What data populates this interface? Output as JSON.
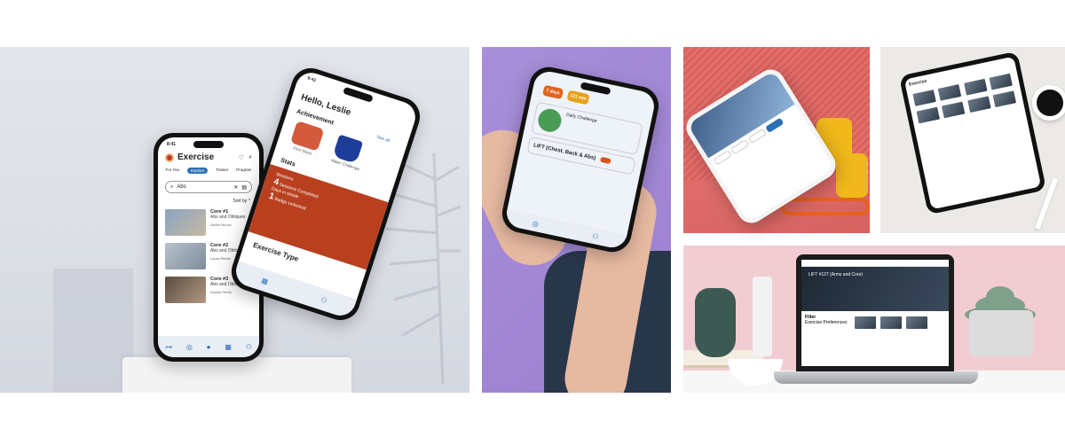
{
  "phone1": {
    "time": "8:41",
    "title": "Exercise",
    "tabs": [
      "For You",
      "Explore",
      "Trainer",
      "Program"
    ],
    "search_value": "Abs",
    "sort_label": "Sort by",
    "cards": [
      {
        "title": "Core #1",
        "subtitle": "Abs and Obliques",
        "author": "Ashim Nunez"
      },
      {
        "title": "Core #2",
        "subtitle": "Abs and Obliques",
        "author": "Laura Reese"
      },
      {
        "title": "Core #3",
        "subtitle": "Abs and Obliques",
        "author": "Amelia Peres"
      }
    ]
  },
  "phone2": {
    "time": "9:41",
    "greeting": "Hello, Leslie",
    "achievement": "Achievement",
    "see_all": "See all",
    "items": [
      "First Steps",
      "Water Challenge"
    ],
    "stats": "Stats",
    "sessions": "Sessions",
    "sessions_count": "4",
    "sessions_label": "Sessions Completed",
    "sessions_day": "Days in streak",
    "badge_count": "1",
    "badge_label": "Badge Unlocked",
    "exercise_type": "Exercise Type"
  },
  "phone3": {
    "badge1": "7 days",
    "badge2": "121 min",
    "challenge_title": "Daily Challenge",
    "lift_label": "LIFT (Chest, Back & Abs)"
  },
  "laptop": {
    "hero_title": "LIFT #127 (Arms and Core)",
    "filter_title": "Filter",
    "filter_sub": "Exercise Preferences"
  },
  "tablet": {
    "title": "Exercise"
  },
  "colors": {
    "brand_blue": "#2d6fb4",
    "accent_orange": "#b8401f",
    "lavender": "#a88fd9",
    "mat_red": "#e36f6b",
    "pink_wall": "#f1cdd3"
  }
}
